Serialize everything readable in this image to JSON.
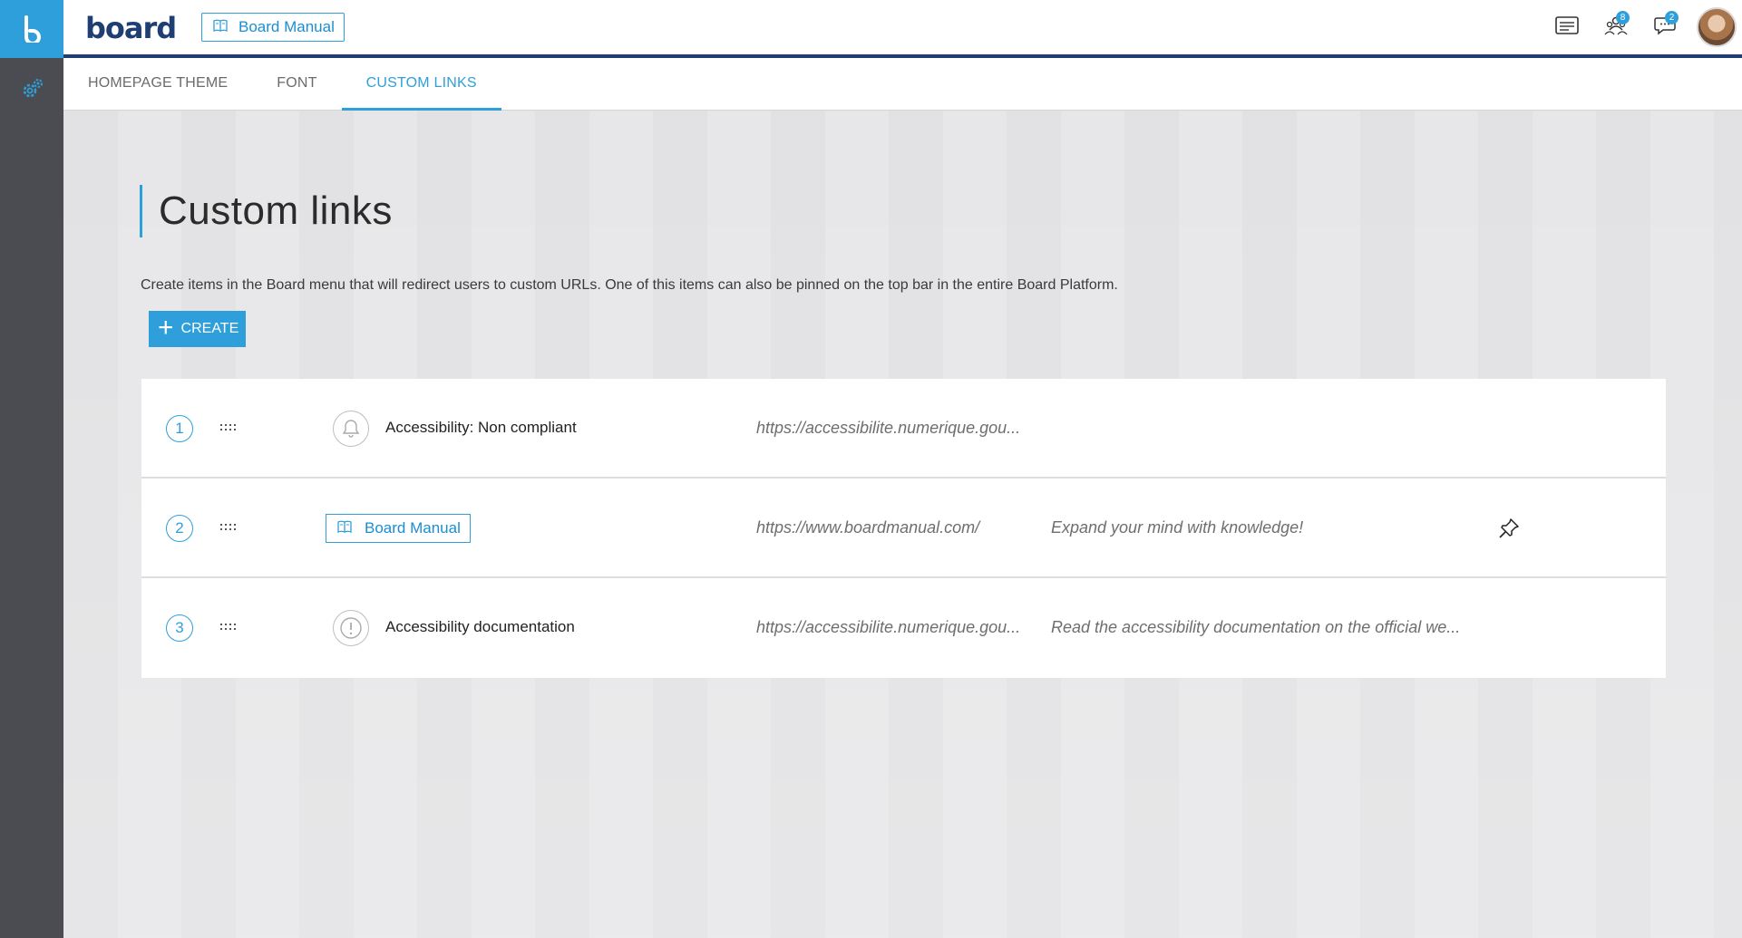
{
  "app": {
    "brand": "board",
    "pinned_link_label": "Board Manual"
  },
  "topbar": {
    "icons": [
      {
        "name": "notes-icon",
        "badge": ""
      },
      {
        "name": "users-icon",
        "badge": "8"
      },
      {
        "name": "chat-icon",
        "badge": "2"
      }
    ]
  },
  "tabs": [
    {
      "label": "HOMEPAGE THEME",
      "active": false
    },
    {
      "label": "FONT",
      "active": false
    },
    {
      "label": "CUSTOM LINKS",
      "active": true
    }
  ],
  "page": {
    "title": "Custom links",
    "description": "Create items in the Board menu that will redirect users to custom URLs. One of this items can also be pinned on the top bar in the entire Board Platform.",
    "create_label": "CREATE"
  },
  "links": [
    {
      "index": "1",
      "icon": "bell-icon",
      "label": "Accessibility: Non compliant",
      "url": "https://accessibilite.numerique.gou...",
      "description": "",
      "pinned": false
    },
    {
      "index": "2",
      "icon": "book-icon",
      "label": "Board Manual",
      "url": "https://www.boardmanual.com/",
      "description": "Expand your mind with knowledge!",
      "pinned": true
    },
    {
      "index": "3",
      "icon": "alert-icon",
      "label": "Accessibility documentation",
      "url": "https://accessibilite.numerique.gou...",
      "description": "Read the accessibility documentation on the official we...",
      "pinned": false
    }
  ],
  "colors": {
    "accent": "#2f9fdb",
    "navy": "#1e3d70",
    "rail": "#4a4c51"
  }
}
